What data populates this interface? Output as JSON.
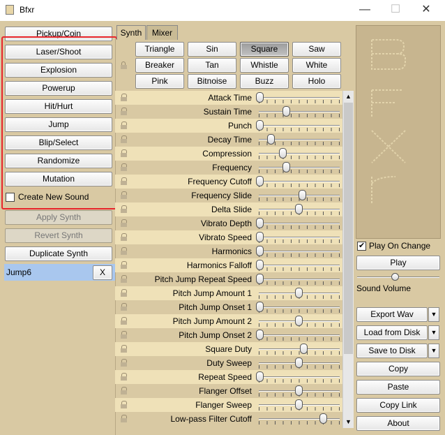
{
  "window": {
    "title": "Bfxr",
    "minimize": "—",
    "maximize": "☐",
    "close": "✕"
  },
  "generators": [
    "Pickup/Coin",
    "Laser/Shoot",
    "Explosion",
    "Powerup",
    "Hit/Hurt",
    "Jump",
    "Blip/Select",
    "Randomize",
    "Mutation"
  ],
  "create_new_sound": {
    "label": "Create New Sound",
    "checked": false
  },
  "synth_actions": {
    "apply": "Apply Synth",
    "revert": "Revert Synth",
    "duplicate": "Duplicate Synth"
  },
  "sound_list": {
    "item": "Jump6",
    "delete": "X"
  },
  "tabs": {
    "synth": "Synth",
    "mixer": "Mixer"
  },
  "waveforms": [
    "Triangle",
    "Sin",
    "Square",
    "Saw",
    "Breaker",
    "Tan",
    "Whistle",
    "White",
    "Pink",
    "Bitnoise",
    "Buzz",
    "Holo"
  ],
  "selected_waveform": "Square",
  "parameters": [
    {
      "label": "Attack Time",
      "value": 0.0
    },
    {
      "label": "Sustain Time",
      "value": 0.34
    },
    {
      "label": "Punch",
      "value": 0.0
    },
    {
      "label": "Decay Time",
      "value": 0.14
    },
    {
      "label": "Compression",
      "value": 0.3
    },
    {
      "label": "Frequency",
      "value": 0.34
    },
    {
      "label": "Frequency Cutoff",
      "value": 0.0
    },
    {
      "label": "Frequency Slide",
      "value": 0.55
    },
    {
      "label": "Delta Slide",
      "value": 0.5
    },
    {
      "label": "Vibrato Depth",
      "value": 0.0
    },
    {
      "label": "Vibrato Speed",
      "value": 0.0
    },
    {
      "label": "Harmonics",
      "value": 0.0
    },
    {
      "label": "Harmonics Falloff",
      "value": 0.0
    },
    {
      "label": "Pitch Jump Repeat Speed",
      "value": 0.0
    },
    {
      "label": "Pitch Jump Amount 1",
      "value": 0.5
    },
    {
      "label": "Pitch Jump Onset 1",
      "value": 0.0
    },
    {
      "label": "Pitch Jump Amount 2",
      "value": 0.5
    },
    {
      "label": "Pitch Jump Onset 2",
      "value": 0.0
    },
    {
      "label": "Square Duty",
      "value": 0.57
    },
    {
      "label": "Duty Sweep",
      "value": 0.5
    },
    {
      "label": "Repeat Speed",
      "value": 0.0
    },
    {
      "label": "Flanger Offset",
      "value": 0.5
    },
    {
      "label": "Flanger Sweep",
      "value": 0.5
    },
    {
      "label": "Low-pass Filter Cutoff",
      "value": 0.82
    }
  ],
  "scroll": {
    "up": "▲",
    "down": "▼"
  },
  "logo_text": "Bfxr",
  "play_on_change": {
    "label": "Play On Change",
    "checked": true
  },
  "play": "Play",
  "sound_volume": {
    "label": "Sound Volume",
    "value": 0.5
  },
  "export_wav": "Export Wav",
  "load_from_disk": "Load from Disk",
  "save_to_disk": "Save to Disk",
  "dropdown_arrow": "▼",
  "copy": "Copy",
  "paste": "Paste",
  "copy_link": "Copy Link",
  "about": "About"
}
